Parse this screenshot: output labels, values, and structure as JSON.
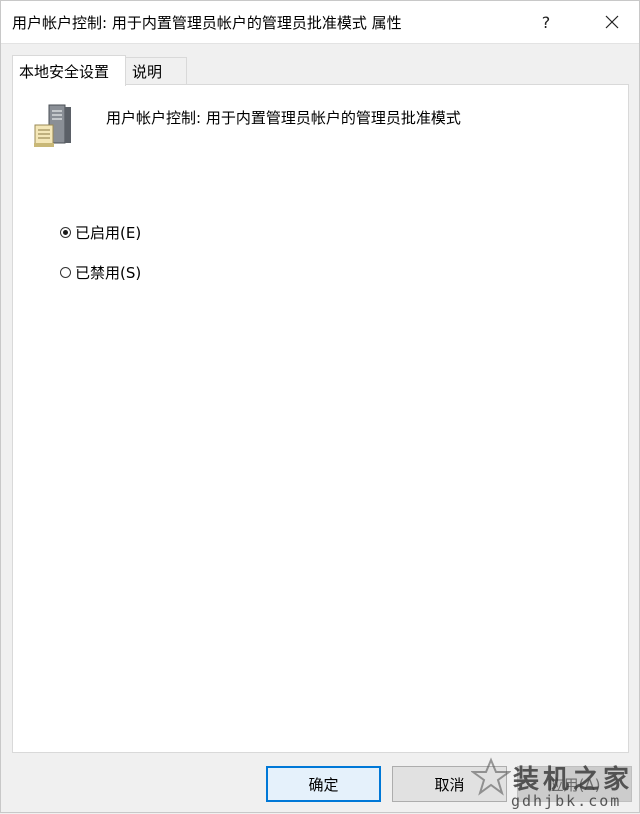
{
  "window": {
    "title": "用户帐户控制: 用于内置管理员帐户的管理员批准模式 属性",
    "help_label": "?",
    "close_icon": "close-icon"
  },
  "tabs": [
    {
      "label": "本地安全设置",
      "selected": true
    },
    {
      "label": "说明",
      "selected": false
    }
  ],
  "panel": {
    "icon": "server-icon",
    "policy_name": "用户帐户控制: 用于内置管理员帐户的管理员批准模式",
    "options": [
      {
        "label": "已启用(E)",
        "checked": true
      },
      {
        "label": "已禁用(S)",
        "checked": false
      }
    ]
  },
  "buttons": {
    "ok": "确定",
    "cancel": "取消",
    "apply": "应用(A)"
  },
  "watermark": {
    "main": "装机之家",
    "sub": "gdhjbk.com"
  },
  "colors": {
    "accent": "#0078d7",
    "panel_bg": "#ffffff",
    "window_bg": "#f0f0f0"
  }
}
